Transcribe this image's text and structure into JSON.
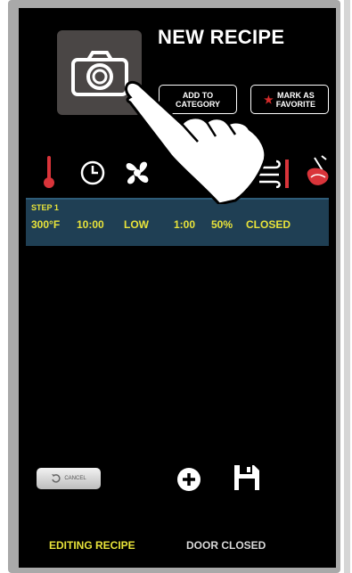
{
  "header": {
    "title": "NEW RECIPE",
    "add_to_category": [
      "ADD TO",
      "CATEGORY"
    ],
    "mark_as_favorite": [
      "MARK AS",
      "FAVORITE"
    ]
  },
  "icons": [
    "thermometer-icon",
    "clock-icon",
    "fan-icon",
    "vent-icon",
    "meat-probe-icon"
  ],
  "step": {
    "label": "STEP 1",
    "temperature": "300°F",
    "time": "10:00",
    "fan": "LOW",
    "probe_time": "1:00",
    "humidity": "50%",
    "vent": "CLOSED"
  },
  "actions": {
    "cancel_label": "CANCEL"
  },
  "footer": {
    "status_left": "EDITING RECIPE",
    "status_right": "DOOR CLOSED"
  },
  "colors": {
    "accent_yellow": "#e8e33a",
    "step_bar": "#1f3f54",
    "favorite_star": "#d42b2b",
    "thermometer_red": "#d9343a"
  }
}
